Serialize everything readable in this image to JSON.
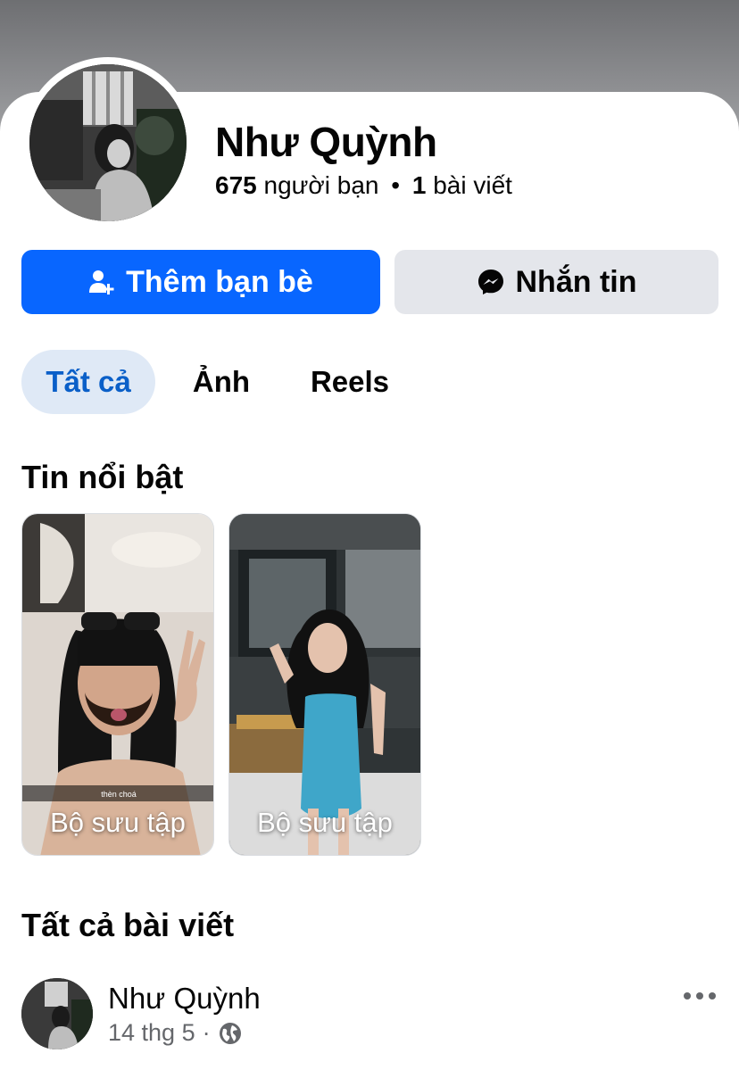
{
  "profile": {
    "name": "Như Quỳnh",
    "friends_count": "675",
    "friends_label": "người bạn",
    "separator": "•",
    "posts_count": "1",
    "posts_label": "bài viết"
  },
  "actions": {
    "add_friend_label": "Thêm bạn bè",
    "add_friend_icon": "add-friend-icon",
    "message_label": "Nhắn tin",
    "message_icon": "messenger-icon",
    "accent_color": "#0866ff"
  },
  "tabs": [
    {
      "label": "Tất cả",
      "active": true
    },
    {
      "label": "Ảnh",
      "active": false
    },
    {
      "label": "Reels",
      "active": false
    }
  ],
  "highlights": {
    "title": "Tin nổi bật",
    "items": [
      {
        "label": "Bộ sưu tập",
        "caption": "thèn choá"
      },
      {
        "label": "Bộ sưu tập"
      }
    ]
  },
  "posts": {
    "title": "Tất cả bài viết",
    "items": [
      {
        "author": "Như Quỳnh",
        "date": "14 thg 5",
        "separator": "·",
        "privacy_icon": "globe-icon",
        "menu_icon": "more-icon"
      }
    ]
  }
}
